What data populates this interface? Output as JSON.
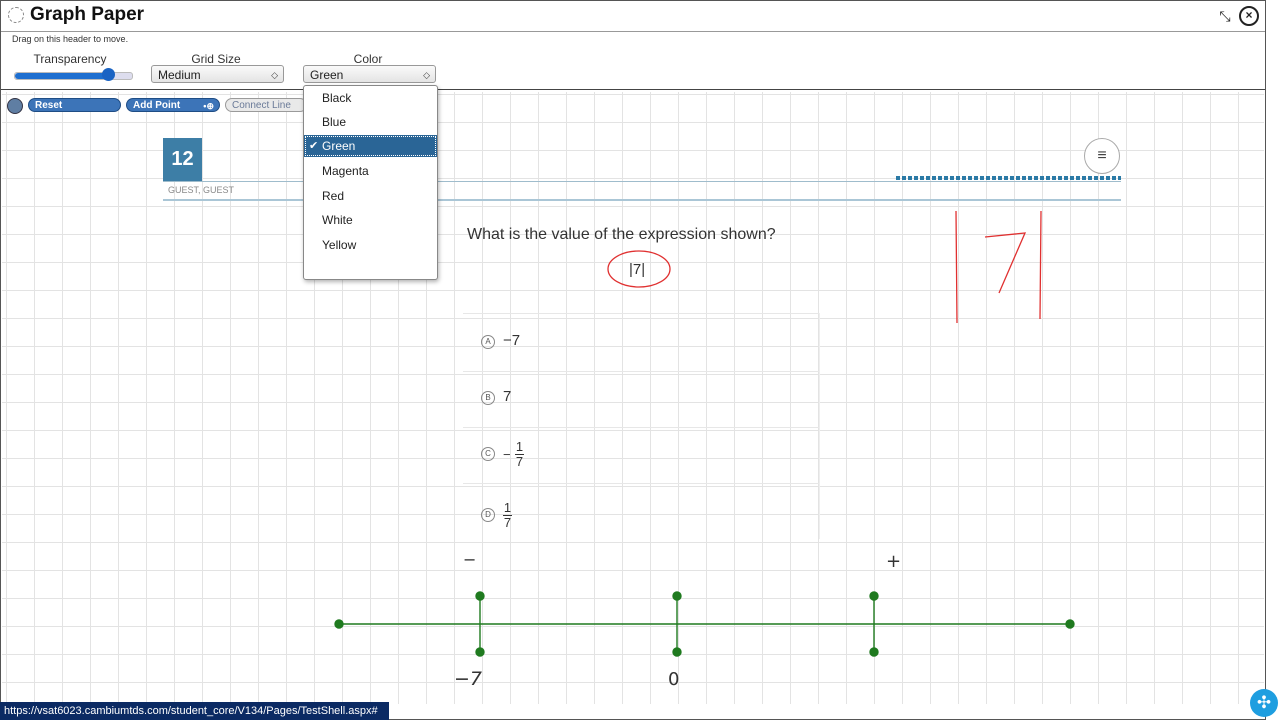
{
  "window": {
    "title": "Graph Paper",
    "drag_hint": "Drag on this header to move."
  },
  "controls": {
    "transparency": {
      "label": "Transparency",
      "value_percent": 85
    },
    "grid_size": {
      "label": "Grid Size",
      "value": "Medium"
    },
    "color": {
      "label": "Color",
      "value": "Green",
      "options": [
        "Black",
        "Blue",
        "Green",
        "Magenta",
        "Red",
        "White",
        "Yellow"
      ]
    }
  },
  "toolbar": {
    "reset": "Reset",
    "add_point": "Add Point",
    "connect_line": "Connect Line"
  },
  "test": {
    "question_number": "12",
    "user": "GUEST, GUEST",
    "question": "What is the value of the expression shown?",
    "expression": "|7|",
    "options": [
      {
        "letter": "A",
        "text": "−7"
      },
      {
        "letter": "B",
        "text": "7"
      },
      {
        "letter": "C",
        "sign": "−",
        "num": "1",
        "den": "7"
      },
      {
        "letter": "D",
        "sign": "",
        "num": "1",
        "den": "7"
      }
    ]
  },
  "drawing": {
    "color": "#1f7a1f",
    "ink_red": "#e03030",
    "labels": {
      "negative": "−",
      "positive": "+",
      "neg_seven": "−7",
      "zero": "0",
      "abs_seven": "|7|"
    }
  },
  "statusbar": {
    "url": "https://vsat6023.cambiumtds.com/student_core/V134/Pages/TestShell.aspx#"
  },
  "colors": {
    "accent": "#3d7ea6",
    "selected": "#2a6596",
    "status_bg": "#0b2a63"
  }
}
